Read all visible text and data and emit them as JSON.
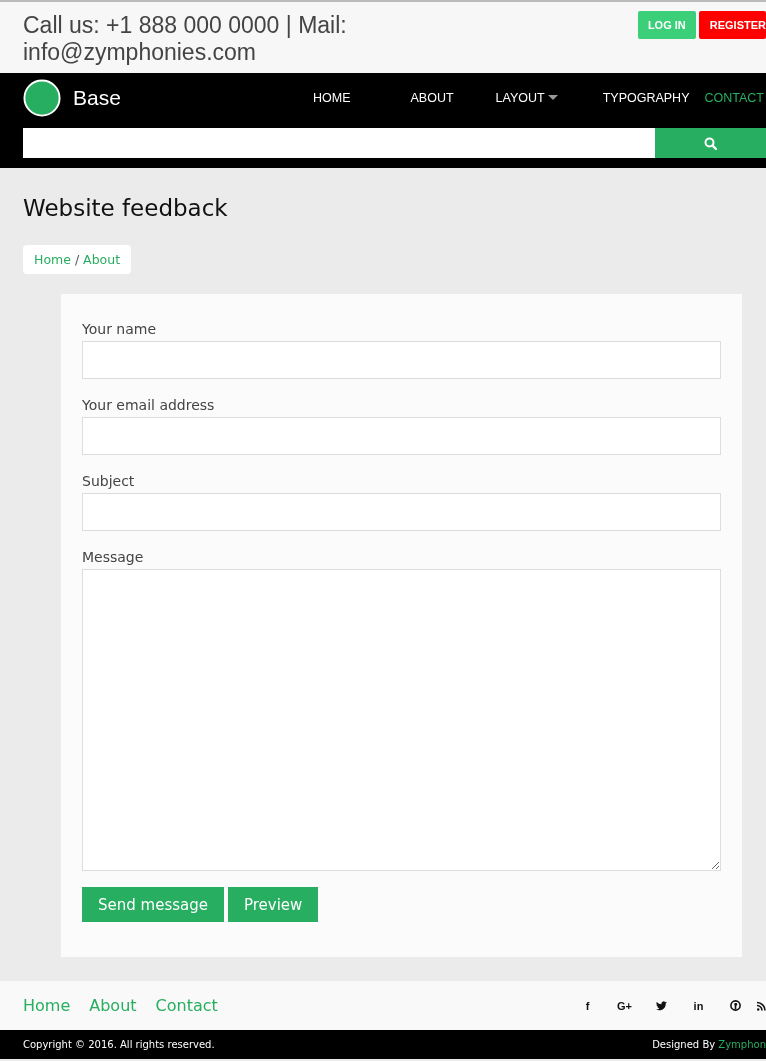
{
  "topbar": {
    "contact": "Call us: +1 888 000 0000 | Mail: info@zymphonies.com",
    "buttons": [
      {
        "label": "LOG IN",
        "kind": "login"
      },
      {
        "label": "REGISTER",
        "kind": "register"
      }
    ]
  },
  "nav": {
    "brand": "Base",
    "items": [
      {
        "label": "HOME",
        "selected": false,
        "has_menu": false
      },
      {
        "label": "ABOUT",
        "selected": false,
        "has_menu": false
      },
      {
        "label": "LAYOUT",
        "selected": false,
        "has_menu": true
      },
      {
        "label": "TYPOGRAPHY",
        "selected": false,
        "has_menu": false
      },
      {
        "label": "CONTACT",
        "selected": true,
        "has_menu": false
      }
    ]
  },
  "page": {
    "title": "Website feedback",
    "breadcrumb": [
      "Home",
      "About"
    ],
    "breadcrumb_separator": "/"
  },
  "form": {
    "fields": [
      {
        "label": "Your name",
        "kind": "text"
      },
      {
        "label": "Your email address",
        "kind": "text"
      },
      {
        "label": "Subject",
        "kind": "text"
      },
      {
        "label": "Message",
        "kind": "textarea"
      }
    ],
    "buttons": [
      "Send message",
      "Preview"
    ]
  },
  "footer": {
    "links": [
      "Home",
      "About",
      "Contact"
    ],
    "social": [
      {
        "kind": "glyph",
        "text": "f"
      },
      {
        "kind": "glyph",
        "text": "G+"
      },
      {
        "kind": "bird"
      },
      {
        "kind": "glyph",
        "text": "in"
      },
      {
        "kind": "pin"
      },
      {
        "kind": "rss"
      }
    ],
    "copyright": "Copyright © 2016. All rights reserved.",
    "designed_by": "Designed By",
    "designer": "Zymphon"
  }
}
